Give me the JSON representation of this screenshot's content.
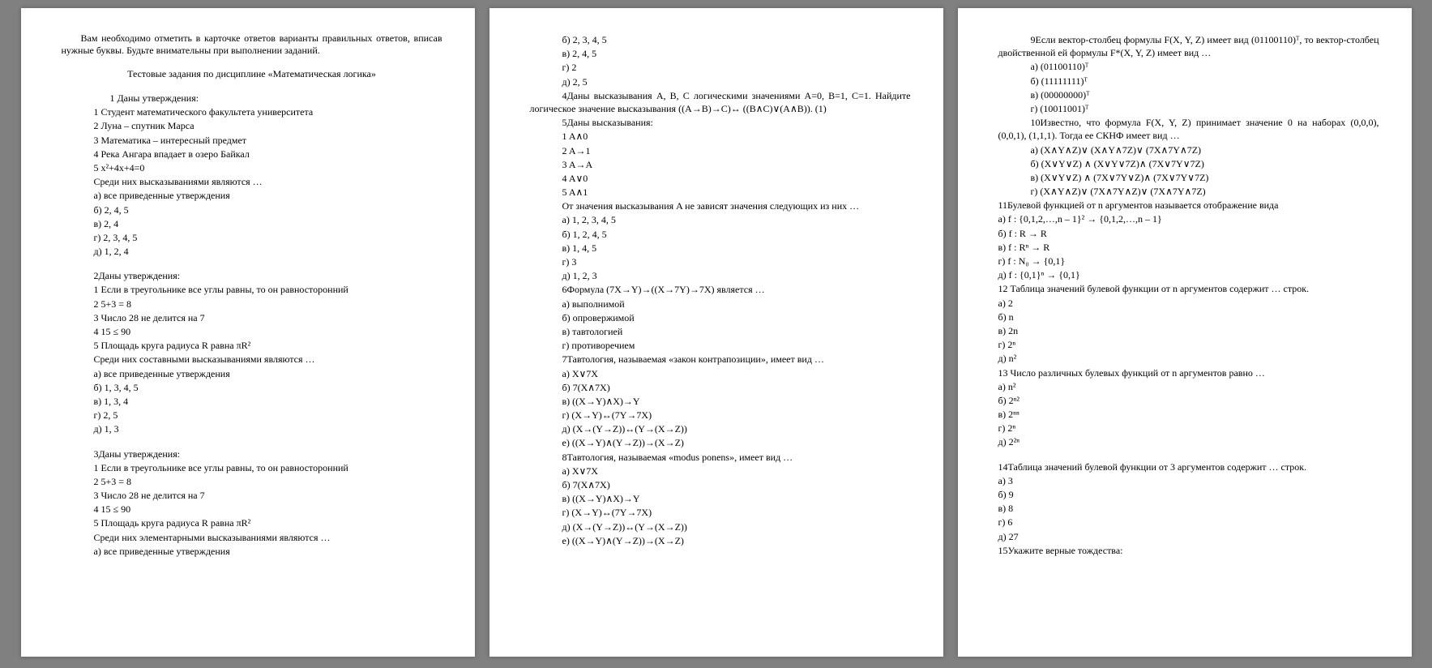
{
  "intro": "Вам необходимо отметить в карточке ответов варианты правильных ответов, вписав нужные буквы. Будьте внимательны при выполнении заданий.",
  "title": "Тестовые задания по дисциплине «Математическая логика»",
  "p1": [
    {
      "cls": "line more",
      "t": "1 Даны утверждения:"
    },
    {
      "cls": "line",
      "t": "1 Студент математического факультета университета"
    },
    {
      "cls": "line",
      "t": "2 Луна – спутник Марса"
    },
    {
      "cls": "line",
      "t": "3 Математика – интересный предмет"
    },
    {
      "cls": "line",
      "t": "4 Река Ангара впадает в озеро Байкал"
    },
    {
      "cls": "line",
      "t": "5 x²+4x+4=0"
    },
    {
      "cls": "line",
      "t": "Среди них высказываниями являются …"
    },
    {
      "cls": "line",
      "t": "а) все приведенные утверждения"
    },
    {
      "cls": "line",
      "t": "б) 2, 4, 5"
    },
    {
      "cls": "line",
      "t": "в) 2, 4"
    },
    {
      "cls": "line",
      "t": "г) 2, 3, 4, 5"
    },
    {
      "cls": "line",
      "t": "д) 1, 2, 4"
    },
    {
      "cls": "line sp",
      "t": " 2Даны утверждения:"
    },
    {
      "cls": "line",
      "t": "1 Если в треугольнике все углы равны, то он равносторонний"
    },
    {
      "cls": "line",
      "t": "2 5+3 = 8"
    },
    {
      "cls": "line",
      "t": "3 Число 28 не делится на 7"
    },
    {
      "cls": "line",
      "t": "4 15 ≤ 90"
    },
    {
      "cls": "line",
      "t": "5 Площадь круга радиуса R равна πR²"
    },
    {
      "cls": "line",
      "t": "Среди них составными высказываниями являются …"
    },
    {
      "cls": "line",
      "t": "а) все приведенные утверждения"
    },
    {
      "cls": "line",
      "t": "б) 1, 3, 4, 5"
    },
    {
      "cls": "line",
      "t": "в) 1, 3, 4"
    },
    {
      "cls": "line",
      "t": "г) 2, 5"
    },
    {
      "cls": "line",
      "t": "д) 1, 3"
    },
    {
      "cls": "line q sp",
      "t": "3Даны утверждения:"
    },
    {
      "cls": "line",
      "t": "1 Если в треугольнике все углы равны, то он равносторонний"
    },
    {
      "cls": "line",
      "t": "2 5+3 = 8"
    },
    {
      "cls": "line",
      "t": "3 Число 28 не делится на 7"
    },
    {
      "cls": "line",
      "t": "4 15 ≤ 90"
    },
    {
      "cls": "line",
      "t": "5 Площадь круга радиуса R равна πR²"
    },
    {
      "cls": "line",
      "t": "Среди них элементарными высказываниями являются …"
    },
    {
      "cls": "line",
      "t": "а) все приведенные утверждения"
    }
  ],
  "p2": [
    {
      "cls": "line",
      "t": "б) 2, 3, 4, 5"
    },
    {
      "cls": "line",
      "t": "в) 2, 4, 5"
    },
    {
      "cls": "line",
      "t": "г) 2"
    },
    {
      "cls": "line",
      "t": "д) 2, 5"
    },
    {
      "cls": "line q",
      "t": "4Даны высказывания A, B, C логическими значениями A=0, B=1, C=1. Найдите логическое значение высказывания ((A→B)→C)↔ ((B∧C)∨(A∧B)). (1)"
    },
    {
      "cls": "line q",
      "t": "5Даны высказывания:"
    },
    {
      "cls": "line",
      "t": "1 A∧0"
    },
    {
      "cls": "line",
      "t": "2 A→1"
    },
    {
      "cls": "line",
      "t": "3 A→A"
    },
    {
      "cls": "line",
      "t": "4 A∨0"
    },
    {
      "cls": "line",
      "t": "5 A∧1"
    },
    {
      "cls": "line",
      "t": "От значения высказывания A не зависят значения следующих из них …"
    },
    {
      "cls": "line",
      "t": "а) 1, 2, 3, 4, 5"
    },
    {
      "cls": "line",
      "t": "б) 1, 2, 4, 5"
    },
    {
      "cls": "line",
      "t": "в) 1, 4, 5"
    },
    {
      "cls": "line",
      "t": "г) 3"
    },
    {
      "cls": "line",
      "t": "д) 1, 2, 3"
    },
    {
      "cls": "line q",
      "t": "6Формула (7X→Y)→((X→7Y)→7X) является …"
    },
    {
      "cls": "line",
      "t": "а) выполнимой"
    },
    {
      "cls": "line",
      "t": "б) опровержимой"
    },
    {
      "cls": "line",
      "t": "в) тавтологией"
    },
    {
      "cls": "line",
      "t": "г) противоречием"
    },
    {
      "cls": "line q",
      "t": "7Тавтология, называемая «закон контрапозиции», имеет вид …"
    },
    {
      "cls": "line",
      "t": "а) X∨7X"
    },
    {
      "cls": "line",
      "t": "б) 7(X∧7X)"
    },
    {
      "cls": "line",
      "t": "в) ((X→Y)∧X)→Y"
    },
    {
      "cls": "line",
      "t": "г) (X→Y)↔(7Y→7X)"
    },
    {
      "cls": "line",
      "t": "д) (X→(Y→Z))↔(Y→(X→Z))"
    },
    {
      "cls": "line",
      "t": "е) ((X→Y)∧(Y→Z))→(X→Z)"
    },
    {
      "cls": "line q",
      "t": "8Тавтология, называемая «modus ponens», имеет вид …"
    },
    {
      "cls": "line",
      "t": "а) X∨7X"
    },
    {
      "cls": "line",
      "t": "б) 7(X∧7X)"
    },
    {
      "cls": "line",
      "t": "в) ((X→Y)∧X)→Y"
    },
    {
      "cls": "line",
      "t": "г) (X→Y)↔(7Y→7X)"
    },
    {
      "cls": "line",
      "t": "д) (X→(Y→Z))↔(Y→(X→Z))"
    },
    {
      "cls": "line",
      "t": "е) ((X→Y)∧(Y→Z))→(X→Z)"
    }
  ],
  "p3": [
    {
      "cls": "line q",
      "t": "9Если вектор-столбец формулы F(X, Y, Z) имеет вид (01100110)ᵀ, то вектор-столбец двойственной ей формулы F*(X, Y, Z) имеет вид …"
    },
    {
      "cls": "line",
      "t": "а) (01100110)ᵀ"
    },
    {
      "cls": "line",
      "t": "б) (11111111)ᵀ"
    },
    {
      "cls": "line",
      "t": "в) (00000000)ᵀ"
    },
    {
      "cls": "line",
      "t": "г) (10011001)ᵀ"
    },
    {
      "cls": "line q",
      "t": "10Известно, что формула F(X, Y, Z) принимает значение 0 на наборах (0,0,0), (0,0,1), (1,1,1). Тогда ее СКНФ имеет вид …"
    },
    {
      "cls": "line",
      "t": "а) (X∧Y∧Z)∨ (X∧Y∧7Z)∨ (7X∧7Y∧7Z)"
    },
    {
      "cls": "line",
      "t": "б) (X∨Y∨Z) ∧ (X∨Y∨7Z)∧ (7X∨7Y∨7Z)"
    },
    {
      "cls": "line",
      "t": "в) (X∨Y∨Z) ∧ (7X∨7Y∨Z)∧ (7X∨7Y∨7Z)"
    },
    {
      "cls": "line",
      "t": "г) (X∧Y∧Z)∨ (7X∧7Y∧Z)∨ (7X∧7Y∧7Z)"
    },
    {
      "cls": "line qless",
      "t": "11Булевой функцией от n аргументов называется отображение вида"
    },
    {
      "cls": "line qless",
      "t": "а) f : {0,1,2,…,n – 1}² → {0,1,2,…,n – 1}"
    },
    {
      "cls": "line qless",
      "t": "б)  f : R → R"
    },
    {
      "cls": "line qless",
      "t": "в) f : Rⁿ → R"
    },
    {
      "cls": "line qless",
      "t": "г) f : N₀ → {0,1}"
    },
    {
      "cls": "line qless",
      "t": "д)  f : {0,1}ⁿ → {0,1}"
    },
    {
      "cls": "line qless",
      "t": "12 Таблица значений булевой функции от n аргументов содержит … строк."
    },
    {
      "cls": "line qless",
      "t": "а) 2"
    },
    {
      "cls": "line qless",
      "t": "б) n"
    },
    {
      "cls": "line qless",
      "t": "в) 2n"
    },
    {
      "cls": "line qless",
      "t": "г) 2ⁿ"
    },
    {
      "cls": "line qless",
      "t": "д) n²"
    },
    {
      "cls": "line qless",
      "t": "13 Число различных булевых функций от n аргументов равно …"
    },
    {
      "cls": "line qless",
      "t": "а) n²"
    },
    {
      "cls": "line qless",
      "t": "б) 2ⁿ²"
    },
    {
      "cls": "line qless",
      "t": "в) 2ⁿⁿ"
    },
    {
      "cls": "line qless",
      "t": "г) 2ⁿ"
    },
    {
      "cls": "line qless",
      "t": "д) 2²ⁿ"
    },
    {
      "cls": "line qless sp",
      "t": "14Таблица значений булевой функции от 3 аргументов содержит … строк."
    },
    {
      "cls": "line qless",
      "t": "а) 3"
    },
    {
      "cls": "line qless",
      "t": "б) 9"
    },
    {
      "cls": "line qless",
      "t": "в) 8"
    },
    {
      "cls": "line qless",
      "t": "г) 6"
    },
    {
      "cls": "line qless",
      "t": "д) 27"
    },
    {
      "cls": "line qless",
      "t": "15Укажите верные тождества:"
    }
  ]
}
